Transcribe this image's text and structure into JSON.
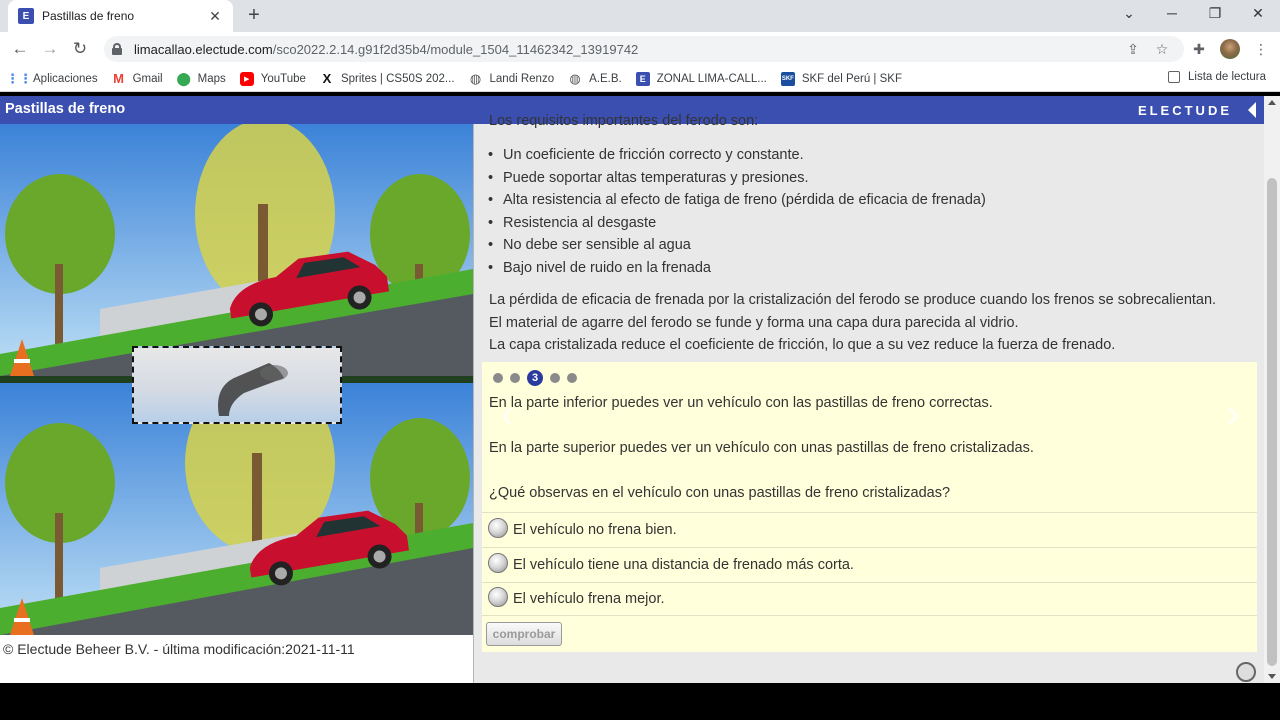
{
  "browser": {
    "tab": {
      "title": "Pastillas de freno",
      "favicon": "E"
    },
    "url_host": "limacallao.electude.com",
    "url_path": "/sco2022.2.14.g91f2d35b4/module_1504_11462342_13919742",
    "bookmarks": [
      {
        "label": "Aplicaciones",
        "icon": "apps-grid-icon",
        "color": "#4285f4"
      },
      {
        "label": "Gmail",
        "icon": "gmail-icon",
        "color": "#ea4335"
      },
      {
        "label": "Maps",
        "icon": "maps-pin-icon",
        "color": "#34a853"
      },
      {
        "label": "YouTube",
        "icon": "youtube-icon",
        "color": "#ff0000"
      },
      {
        "label": "Sprites | CS50S 202...",
        "icon": "x-logo-icon",
        "color": "#111111"
      },
      {
        "label": "Landi Renzo",
        "icon": "globe-icon",
        "color": "#555555"
      },
      {
        "label": "A.E.B.",
        "icon": "globe-icon",
        "color": "#555555"
      },
      {
        "label": "ZONAL LIMA-CALL...",
        "icon": "electude-e-icon",
        "color": "#3b4fb0"
      },
      {
        "label": "SKF del Perú | SKF",
        "icon": "skf-icon",
        "color": "#1a4fa0"
      }
    ],
    "reading_list": "Lista de lectura"
  },
  "header": {
    "title": "Pastillas de freno",
    "logo": "ELECTUDE",
    "accent": "#3b4fb0"
  },
  "footer_note": "© Electude Beheer B.V. - última modificación:2021-11-11",
  "content": {
    "cut_line": "Los requisitos importantes del ferodo son:",
    "requirements": [
      "Un coeficiente de fricción correcto y constante.",
      "Puede soportar altas temperaturas y presiones.",
      "Alta resistencia al efecto de fatiga de freno (pérdida de eficacia de frenada)",
      "Resistencia al desgaste",
      "No debe ser sensible al agua",
      "Bajo nivel de ruido en la frenada"
    ],
    "paragraph": [
      "La pérdida de eficacia de frenada por la cristalización del ferodo se produce cuando los frenos se sobrecalientan.",
      "El material de agarre del ferodo se funde y forma una capa dura parecida al vidrio.",
      "La capa cristalizada reduce el coeficiente de fricción, lo que a su vez reduce la fuerza de frenado."
    ]
  },
  "question": {
    "active_step": "3",
    "step_count": 5,
    "lines": [
      "En la parte inferior puedes ver un vehículo con las pastillas de freno correctas.",
      "En la parte superior puedes ver un vehículo con unas pastillas de freno cristalizadas.",
      "¿Qué observas en el vehículo con unas pastillas de freno cristalizadas?"
    ],
    "options": [
      "El vehículo no frena bien.",
      "El vehículo tiene una distancia de frenado más corta.",
      "El vehículo frena mejor."
    ],
    "check_label": "comprobar",
    "box_color": "#ffffdb"
  }
}
